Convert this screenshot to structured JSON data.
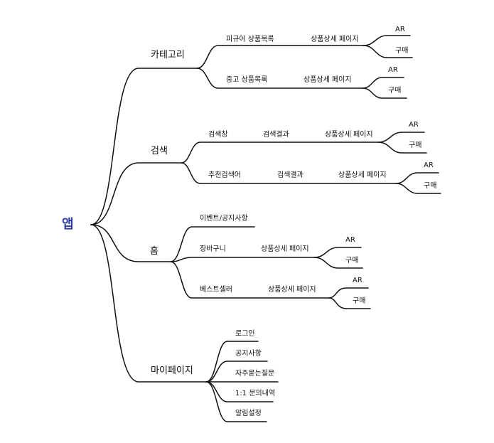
{
  "mindmap": {
    "root": "앱",
    "categories": {
      "label": "카테고리",
      "figure_list": "피규어 상품목록",
      "used_list": "중고 상품목록",
      "product_detail": "상품상세 페이지",
      "ar": "AR",
      "buy": "구매"
    },
    "search": {
      "label": "검색",
      "search_bar": "검색창",
      "recommended": "추천검색어",
      "results": "검색결과",
      "product_detail": "상품상세 페이지",
      "ar": "AR",
      "buy": "구매"
    },
    "home": {
      "label": "홈",
      "events": "이벤트/공지사항",
      "cart": "장바구니",
      "best": "베스트셀러",
      "product_detail": "상품상세 페이지",
      "ar": "AR",
      "buy": "구매"
    },
    "mypage": {
      "label": "마이페이지",
      "items": [
        "로그인",
        "공지사항",
        "자주묻는질문",
        "1:1 문의내역",
        "알림설정"
      ]
    }
  }
}
